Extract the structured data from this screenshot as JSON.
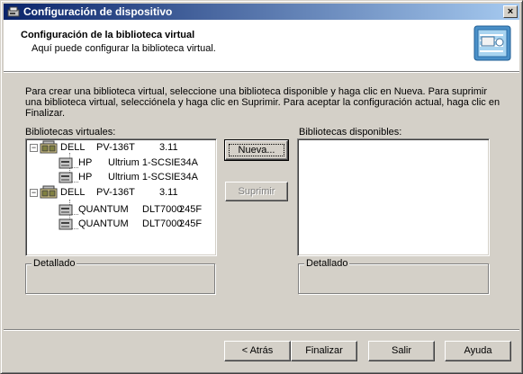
{
  "window": {
    "title": "Configuración de dispositivo",
    "close_glyph": "×"
  },
  "header": {
    "title": "Configuración de la biblioteca virtual",
    "subtitle": "Aquí puede configurar la biblioteca virtual."
  },
  "description": "Para crear una biblioteca virtual, seleccione una biblioteca disponible y haga clic en Nueva. Para suprimir una biblioteca virtual, selecciónela y haga clic en Suprimir. Para aceptar la configuración actual, haga clic en Finalizar.",
  "virtual_libraries": {
    "label": "Bibliotecas virtuales:",
    "items": [
      {
        "vendor": "DELL",
        "model": "PV-136T",
        "rev": "3.11",
        "expander": "−",
        "children": [
          {
            "vendor": "HP",
            "model": "Ultrium 1-SCSI",
            "rev": "E34A"
          },
          {
            "vendor": "HP",
            "model": "Ultrium 1-SCSI",
            "rev": "E34A"
          }
        ]
      },
      {
        "vendor": "DELL",
        "model": "PV-136T",
        "rev": "3.11",
        "expander": "−",
        "children": [
          {
            "vendor": "QUANTUM",
            "model": "DLT7000",
            "rev": "245F"
          },
          {
            "vendor": "QUANTUM",
            "model": "DLT7000",
            "rev": "245F"
          }
        ]
      }
    ]
  },
  "available_libraries": {
    "label": "Bibliotecas disponibles:"
  },
  "details_left": {
    "legend": "Detallado"
  },
  "details_right": {
    "legend": "Detallado"
  },
  "buttons": {
    "new": "Nueva...",
    "delete": "Suprimir",
    "back": "< Atrás",
    "finish": "Finalizar",
    "exit": "Salir",
    "help": "Ayuda"
  },
  "icons": {
    "app": "device-config-icon",
    "header_logo": "library-wizard-icon",
    "library": "tape-library-icon",
    "drive": "tape-drive-icon"
  }
}
